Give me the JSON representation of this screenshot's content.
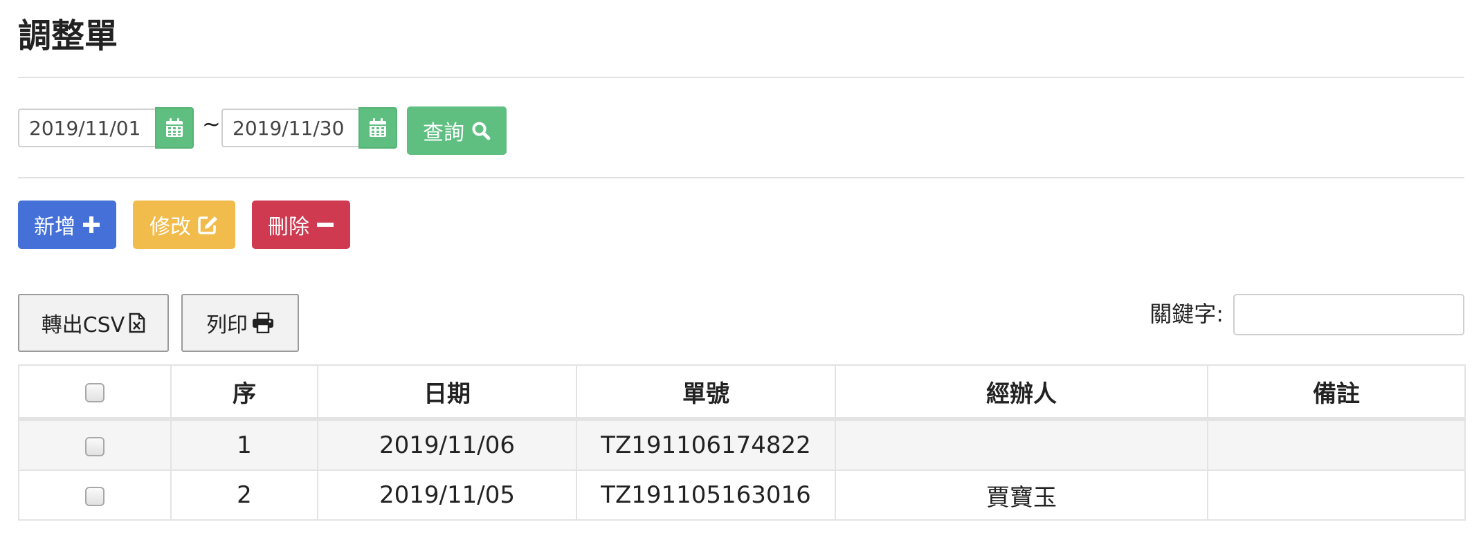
{
  "page": {
    "title": "調整單"
  },
  "filter": {
    "start_date": "2019/11/01",
    "end_date": "2019/11/30",
    "separator": "~",
    "query_label": "查詢"
  },
  "actions": {
    "add_label": "新增",
    "edit_label": "修改",
    "delete_label": "刪除"
  },
  "toolbar": {
    "csv_label": "轉出CSV",
    "print_label": "列印",
    "keyword_label": "關鍵字:",
    "keyword_value": ""
  },
  "table": {
    "headers": [
      "序",
      "日期",
      "單號",
      "經辦人",
      "備註"
    ],
    "rows": [
      {
        "seq": "1",
        "date": "2019/11/06",
        "number": "TZ191106174822",
        "handler": "",
        "note": ""
      },
      {
        "seq": "2",
        "date": "2019/11/05",
        "number": "TZ191105163016",
        "handler": "賈寶玉",
        "note": ""
      }
    ]
  },
  "colors": {
    "green": "#5fbf80",
    "blue": "#4570d8",
    "yellow": "#f1bc4c",
    "red": "#cf3a51"
  },
  "icons": [
    "calendar-icon",
    "search-icon",
    "plus-icon",
    "edit-icon",
    "minus-icon",
    "file-excel-icon",
    "print-icon"
  ]
}
